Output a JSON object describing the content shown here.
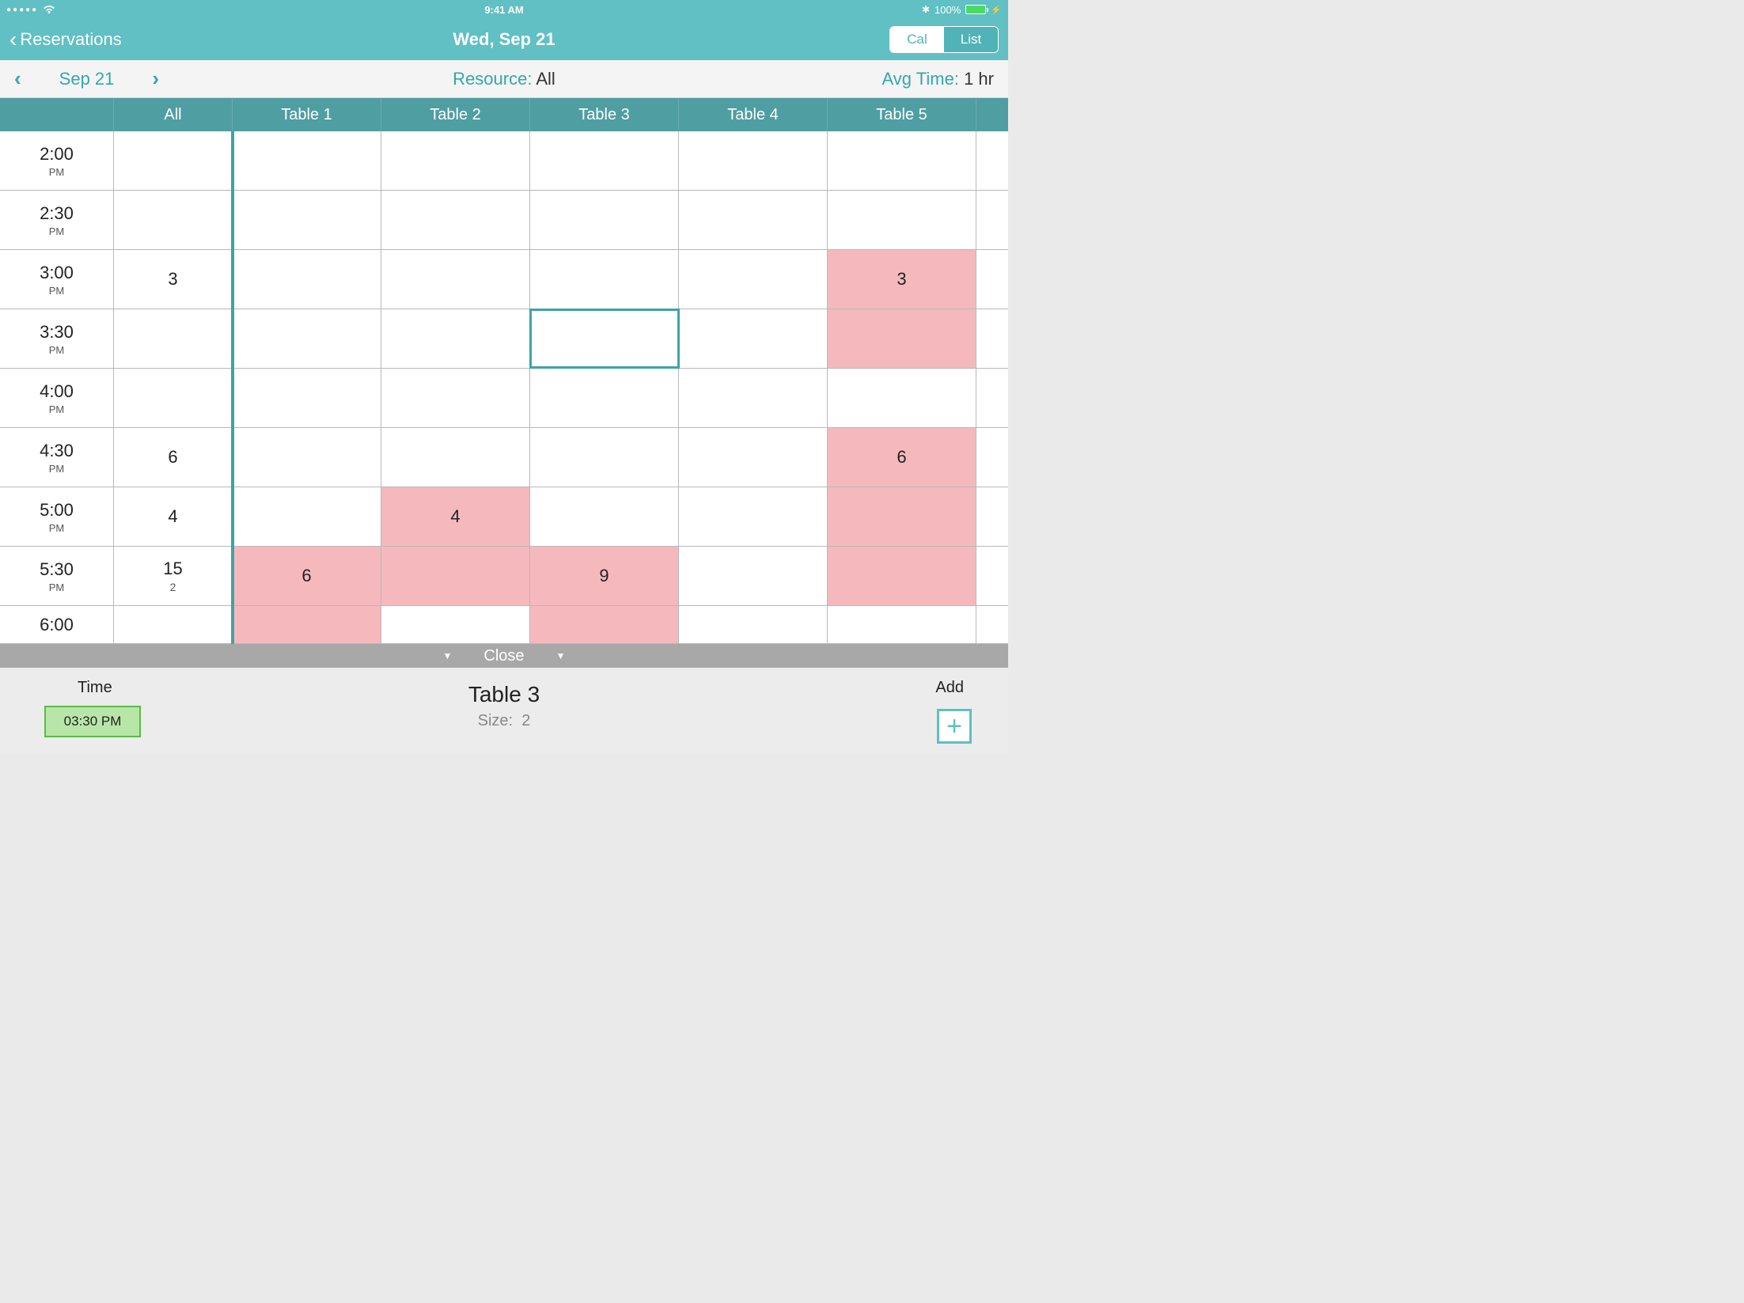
{
  "status": {
    "time": "9:41 AM",
    "battery": "100%"
  },
  "nav": {
    "back_label": "Reservations",
    "title": "Wed, Sep 21",
    "seg_cal": "Cal",
    "seg_list": "List",
    "seg_selected": "Cal"
  },
  "sub": {
    "date": "Sep 21",
    "resource_label": "Resource:",
    "resource_value": "All",
    "avg_label": "Avg Time:",
    "avg_value": "1 hr"
  },
  "columns": {
    "all": "All",
    "resources": [
      "Table 1",
      "Table 2",
      "Table 3",
      "Table 4",
      "Table 5"
    ]
  },
  "times": [
    {
      "t": "2:00",
      "p": "PM"
    },
    {
      "t": "2:30",
      "p": "PM"
    },
    {
      "t": "3:00",
      "p": "PM"
    },
    {
      "t": "3:30",
      "p": "PM"
    },
    {
      "t": "4:00",
      "p": "PM"
    },
    {
      "t": "4:30",
      "p": "PM"
    },
    {
      "t": "5:00",
      "p": "PM"
    },
    {
      "t": "5:30",
      "p": "PM"
    },
    {
      "t": "6:00",
      "p": ""
    }
  ],
  "all_col": [
    {
      "v": "",
      "s": ""
    },
    {
      "v": "",
      "s": ""
    },
    {
      "v": "3",
      "s": ""
    },
    {
      "v": "",
      "s": ""
    },
    {
      "v": "",
      "s": ""
    },
    {
      "v": "6",
      "s": ""
    },
    {
      "v": "4",
      "s": ""
    },
    {
      "v": "15",
      "s": "2"
    },
    {
      "v": "",
      "s": ""
    }
  ],
  "grid": [
    [
      {
        "v": "",
        "c": ""
      },
      {
        "v": "",
        "c": ""
      },
      {
        "v": "",
        "c": ""
      },
      {
        "v": "",
        "c": ""
      },
      {
        "v": "",
        "c": ""
      }
    ],
    [
      {
        "v": "",
        "c": ""
      },
      {
        "v": "",
        "c": ""
      },
      {
        "v": "",
        "c": ""
      },
      {
        "v": "",
        "c": ""
      },
      {
        "v": "",
        "c": ""
      }
    ],
    [
      {
        "v": "",
        "c": ""
      },
      {
        "v": "",
        "c": ""
      },
      {
        "v": "",
        "c": ""
      },
      {
        "v": "",
        "c": ""
      },
      {
        "v": "3",
        "c": "pink"
      }
    ],
    [
      {
        "v": "",
        "c": ""
      },
      {
        "v": "",
        "c": ""
      },
      {
        "v": "",
        "c": "sel"
      },
      {
        "v": "",
        "c": ""
      },
      {
        "v": "",
        "c": "pink"
      }
    ],
    [
      {
        "v": "",
        "c": ""
      },
      {
        "v": "",
        "c": ""
      },
      {
        "v": "",
        "c": ""
      },
      {
        "v": "",
        "c": ""
      },
      {
        "v": "",
        "c": ""
      }
    ],
    [
      {
        "v": "",
        "c": ""
      },
      {
        "v": "",
        "c": ""
      },
      {
        "v": "",
        "c": ""
      },
      {
        "v": "",
        "c": ""
      },
      {
        "v": "6",
        "c": "pink"
      }
    ],
    [
      {
        "v": "",
        "c": ""
      },
      {
        "v": "4",
        "c": "pink"
      },
      {
        "v": "",
        "c": ""
      },
      {
        "v": "",
        "c": ""
      },
      {
        "v": "",
        "c": "pink"
      }
    ],
    [
      {
        "v": "6",
        "c": "pink"
      },
      {
        "v": "",
        "c": "pink"
      },
      {
        "v": "9",
        "c": "pink"
      },
      {
        "v": "",
        "c": ""
      },
      {
        "v": "",
        "c": "pink"
      }
    ],
    [
      {
        "v": "",
        "c": "pink"
      },
      {
        "v": "",
        "c": ""
      },
      {
        "v": "",
        "c": "pink"
      },
      {
        "v": "",
        "c": ""
      },
      {
        "v": "",
        "c": ""
      }
    ]
  ],
  "close": "Close",
  "bottom": {
    "time_label": "Time",
    "time_value": "03:30 PM",
    "resource_name": "Table 3",
    "size_label": "Size:",
    "size_value": "2",
    "add_label": "Add"
  }
}
